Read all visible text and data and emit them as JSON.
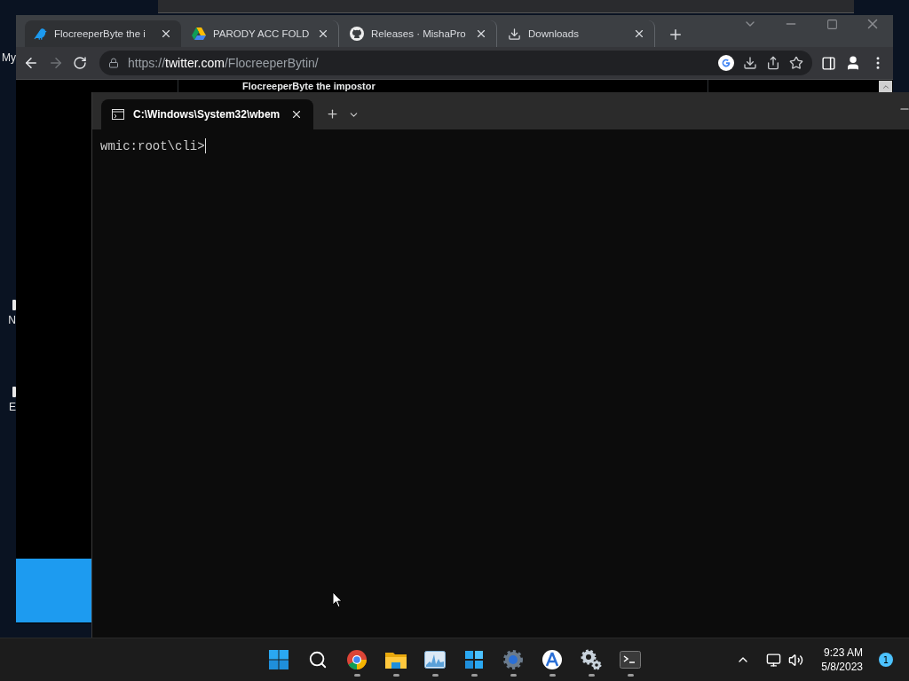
{
  "desktop": {
    "icon_labels": [
      "My",
      "N",
      "E"
    ]
  },
  "browser": {
    "tabs": [
      {
        "kind": "twitter",
        "title": "FlocreeperByte the i",
        "selected": true
      },
      {
        "kind": "drive",
        "title": "PARODY ACC FOLD",
        "selected": false
      },
      {
        "kind": "github",
        "title": "Releases · MishaPro",
        "selected": false
      },
      {
        "kind": "download",
        "title": "Downloads",
        "selected": false
      }
    ],
    "url": "https://**twitter.com**/FlocreeperBytin/",
    "page": {
      "heading": "FlocreeperByte the impostor"
    }
  },
  "terminal": {
    "tab": {
      "title": "C:\\Windows\\System32\\wbem",
      "selected": true
    },
    "prompt": "wmic:root\\cli>"
  },
  "taskbar": {
    "apps": [
      {
        "kind": "start",
        "running": false
      },
      {
        "kind": "search",
        "running": false
      },
      {
        "kind": "chrome",
        "running": true
      },
      {
        "kind": "explorer",
        "running": true
      },
      {
        "kind": "monitor",
        "running": true
      },
      {
        "kind": "widgets",
        "running": true
      },
      {
        "kind": "gear",
        "running": true
      },
      {
        "kind": "compass",
        "running": true
      },
      {
        "kind": "gears",
        "running": true
      },
      {
        "kind": "terminal",
        "running": true
      }
    ],
    "clock": {
      "time": "9:23 AM",
      "date": "5/8/2023"
    },
    "notification_count": "1"
  }
}
